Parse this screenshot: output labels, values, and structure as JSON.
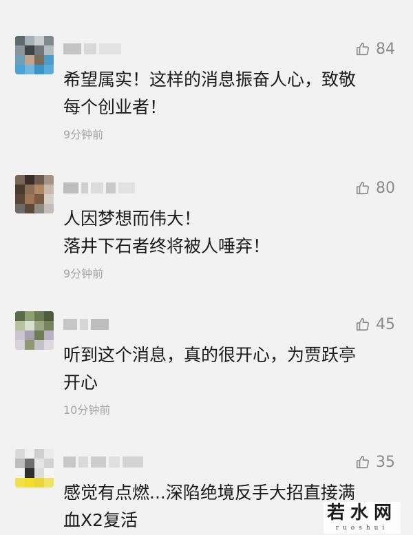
{
  "comments": [
    {
      "likes": "84",
      "text": "希望属实！这样的消息振奋人心，致敬\n每个创业者！",
      "time": "9分钟前"
    },
    {
      "likes": "80",
      "text": "人因梦想而伟大！\n落井下石者终将被人唾弃！",
      "time": "9分钟前"
    },
    {
      "likes": "45",
      "text": "听到这个消息，真的很开心，为贾跃亭\n开心",
      "time": "10分钟前"
    },
    {
      "likes": "35",
      "text": "感觉有点燃...深陷绝境反手大招直接满\n血X2复活",
      "time": ""
    }
  ],
  "icons": {
    "like": "thumbs-up-icon"
  },
  "colors": {
    "background": "#f2f2f2",
    "text": "#1a1a1a",
    "muted": "#a6a6a6",
    "like": "#8a8a8a"
  },
  "watermark": {
    "main": "若水网",
    "sub": "ruoshui"
  }
}
